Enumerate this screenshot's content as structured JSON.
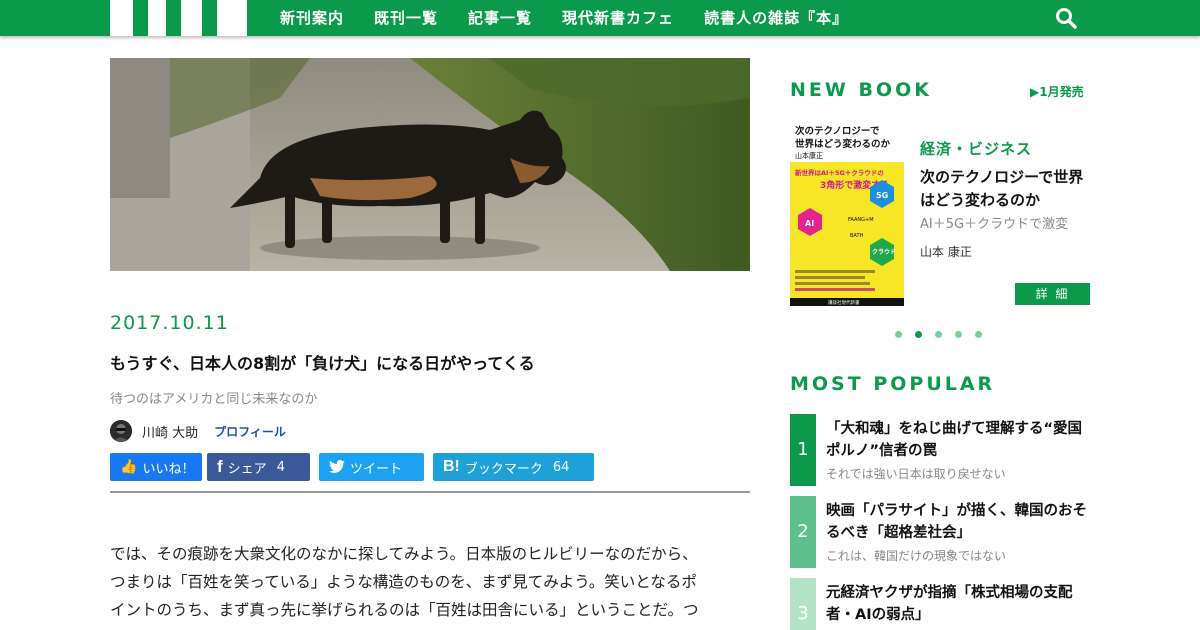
{
  "nav": {
    "items": [
      "新刊案内",
      "既刊一覧",
      "記事一覧",
      "現代新書カフェ",
      "読書人の雑誌『本』"
    ]
  },
  "article": {
    "date": "2017.10.11",
    "title": "もうすぐ、日本人の8割が「負け犬」になる日がやってくる",
    "subtitle": "待つのはアメリカと同じ未来なのか",
    "author": "川崎 大助",
    "profile_label": "プロフィール",
    "share": {
      "like_label": "いいね！",
      "facebook_label": "シェア",
      "facebook_count": "4",
      "twitter_label": "ツイート",
      "hatena_label": "ブックマーク",
      "hatena_count": "64"
    },
    "body": [
      "では、その痕跡を大衆文化のなかに探してみよう。日本版のヒルビリーなのだから、",
      "つまりは「百姓を笑っている」ような構造のものを、まず見てみよう。笑いとなるポ",
      "イントのうち、まず真っ先に挙げられるのは「百姓は田舎にいる」ということだ。つ"
    ]
  },
  "sidebar": {
    "new_book": {
      "heading": "NEW BOOK",
      "release": "▶1月発売",
      "category": "経済・ビジネス",
      "title": "次のテクノロジーで世界はどう変わるのか",
      "subtitle": "AI＋5G＋クラウドで激変",
      "author": "山本 康正",
      "more_label": "詳 細",
      "cover": {
        "title_line1": "次のテクノロジーで",
        "title_line2": "世界はどう変わるのか",
        "author": "山本康正",
        "tagline1": "新世界はAI＋5G＋クラウドの",
        "tagline2": "3角形で激変する",
        "hex_top": "5G",
        "hex_left": "AI",
        "hex_right": "クラウド",
        "center": "FAANG+M",
        "center2": "BATH",
        "publisher": "講談社現代新書"
      },
      "carousel_active": 1,
      "carousel_count": 5
    },
    "popular": {
      "heading": "MOST POPULAR",
      "items": [
        {
          "rank": "1",
          "title": "「大和魂」をねじ曲げて理解する“愛国ポルノ”信者の罠",
          "sub": "それでは強い日本は取り戻せない"
        },
        {
          "rank": "2",
          "title": "映画「パラサイト」が描く、韓国のおそるべき「超格差社会」",
          "sub": "これは、韓国だけの現象ではない"
        },
        {
          "rank": "3",
          "title": "元経済ヤクザが指摘「株式相場の支配者・AIの弱点」",
          "sub": ""
        }
      ]
    }
  },
  "colors": {
    "brand": "#0b9a4b",
    "rank1": "#0b9a4b",
    "rank2": "#5cc08a",
    "rank3": "#b4e3c7"
  }
}
